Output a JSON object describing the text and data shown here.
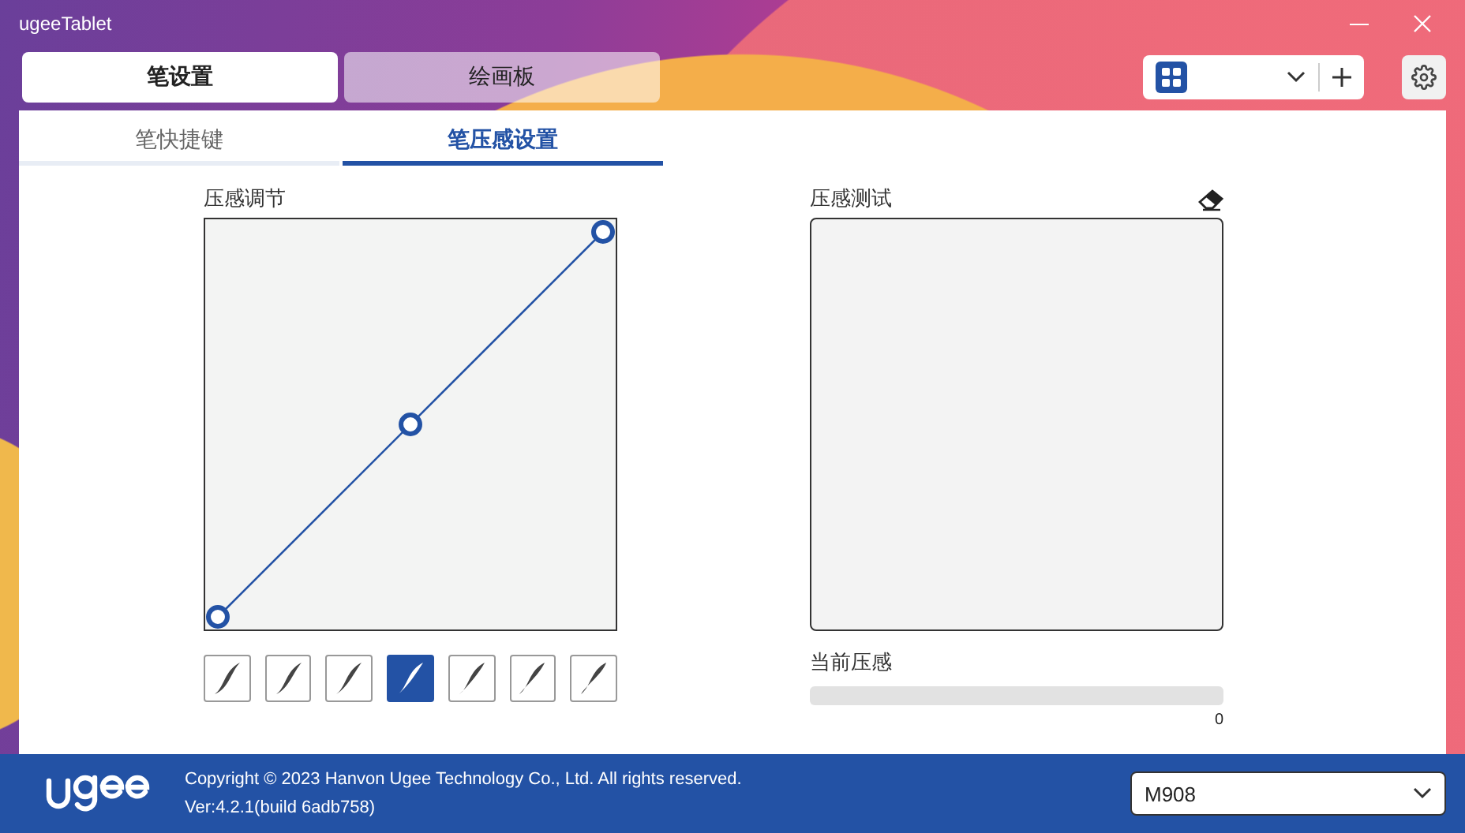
{
  "window": {
    "title": "ugeeTablet"
  },
  "main_tabs": [
    {
      "label": "笔设置",
      "selected": true
    },
    {
      "label": "绘画板",
      "selected": false
    }
  ],
  "sub_tabs": [
    {
      "label": "笔快捷键",
      "selected": false
    },
    {
      "label": "笔压感设置",
      "selected": true
    }
  ],
  "pressure_adjust": {
    "label": "压感调节",
    "presets": [
      {
        "selected": false
      },
      {
        "selected": false
      },
      {
        "selected": false
      },
      {
        "selected": true
      },
      {
        "selected": false
      },
      {
        "selected": false
      },
      {
        "selected": false
      }
    ]
  },
  "pressure_test": {
    "label": "压感测试",
    "current_label": "当前压感",
    "level": 0,
    "reading": "0"
  },
  "footer": {
    "copyright": "Copyright © 2023 Hanvon Ugee Technology Co., Ltd. All rights reserved.",
    "version": "Ver:4.2.1(build 6adb758)",
    "device": "M908"
  }
}
